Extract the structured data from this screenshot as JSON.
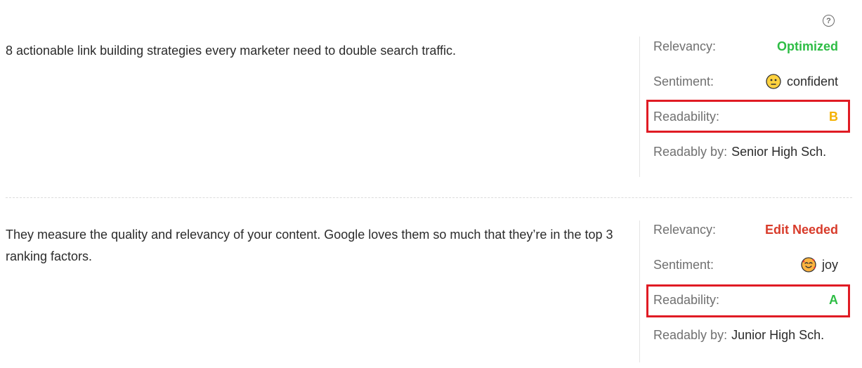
{
  "help_label": "?",
  "rows": [
    {
      "text": "8 actionable link building strategies every marketer need to double search traffic.",
      "relevancy_label": "Relevancy:",
      "relevancy_value": "Optimized",
      "relevancy_color": "#2ebd45",
      "sentiment_label": "Sentiment:",
      "sentiment_icon": "neutral-face-icon",
      "sentiment_value": "confident",
      "readability_label": "Readability:",
      "readability_value": "B",
      "readability_color": "#f4b100",
      "readably_label": "Readably by:",
      "readably_value": "Senior High Sch."
    },
    {
      "text": "They measure the quality and relevancy of your content. Google loves them so much that they’re in the top 3 ranking factors.",
      "relevancy_label": "Relevancy:",
      "relevancy_value": "Edit Needed",
      "relevancy_color": "#d83b2a",
      "sentiment_label": "Sentiment:",
      "sentiment_icon": "smiling-hearts-face-icon",
      "sentiment_value": "joy",
      "readability_label": "Readability:",
      "readability_value": "A",
      "readability_color": "#2ebd45",
      "readably_label": "Readably by:",
      "readably_value": "Junior High Sch."
    }
  ],
  "highlight_color": "#e01b24"
}
